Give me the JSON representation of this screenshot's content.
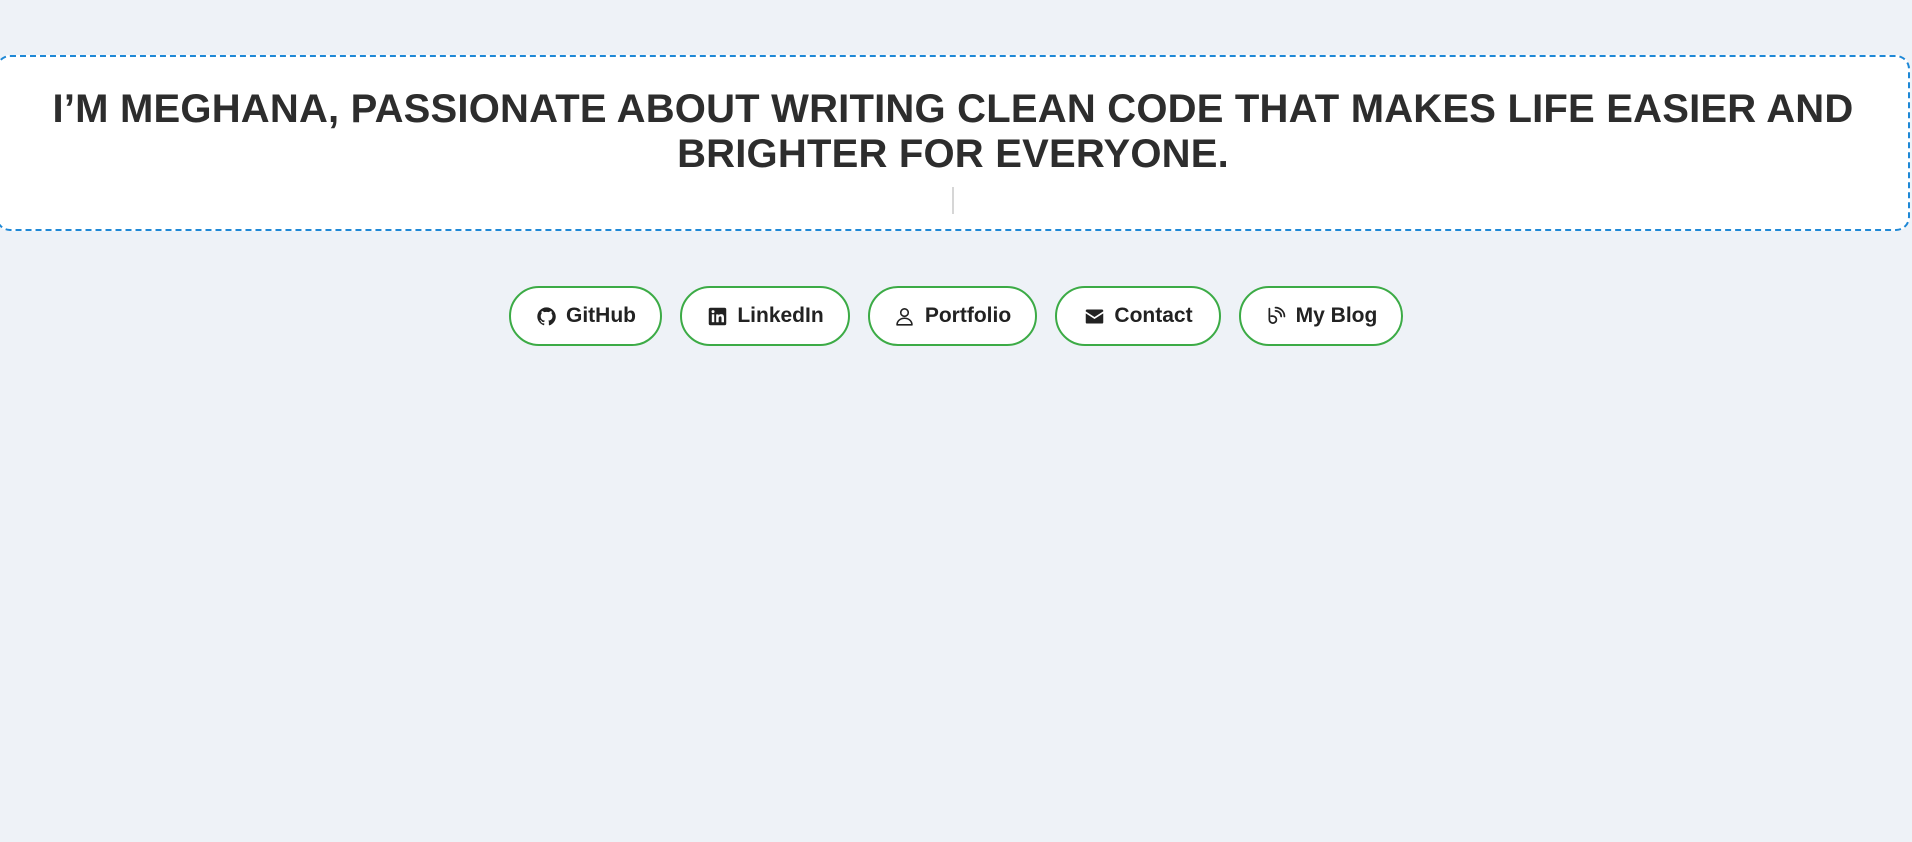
{
  "hero": {
    "title": "I’M MEGHANA, PASSIONATE ABOUT WRITING CLEAN CODE THAT MAKES LIFE EASIER AND BRIGHTER FOR EVERYONE."
  },
  "links": {
    "github": {
      "label": "GitHub",
      "icon": "github-icon"
    },
    "linkedin": {
      "label": "LinkedIn",
      "icon": "linkedin-icon"
    },
    "portfolio": {
      "label": "Portfolio",
      "icon": "user-icon"
    },
    "contact": {
      "label": "Contact",
      "icon": "envelope-icon"
    },
    "blog": {
      "label": "My Blog",
      "icon": "blog-icon"
    }
  },
  "colors": {
    "background": "#eef2f7",
    "card_border": "#1e88d6",
    "button_border": "#3cab46",
    "text": "#2d2d2d"
  }
}
